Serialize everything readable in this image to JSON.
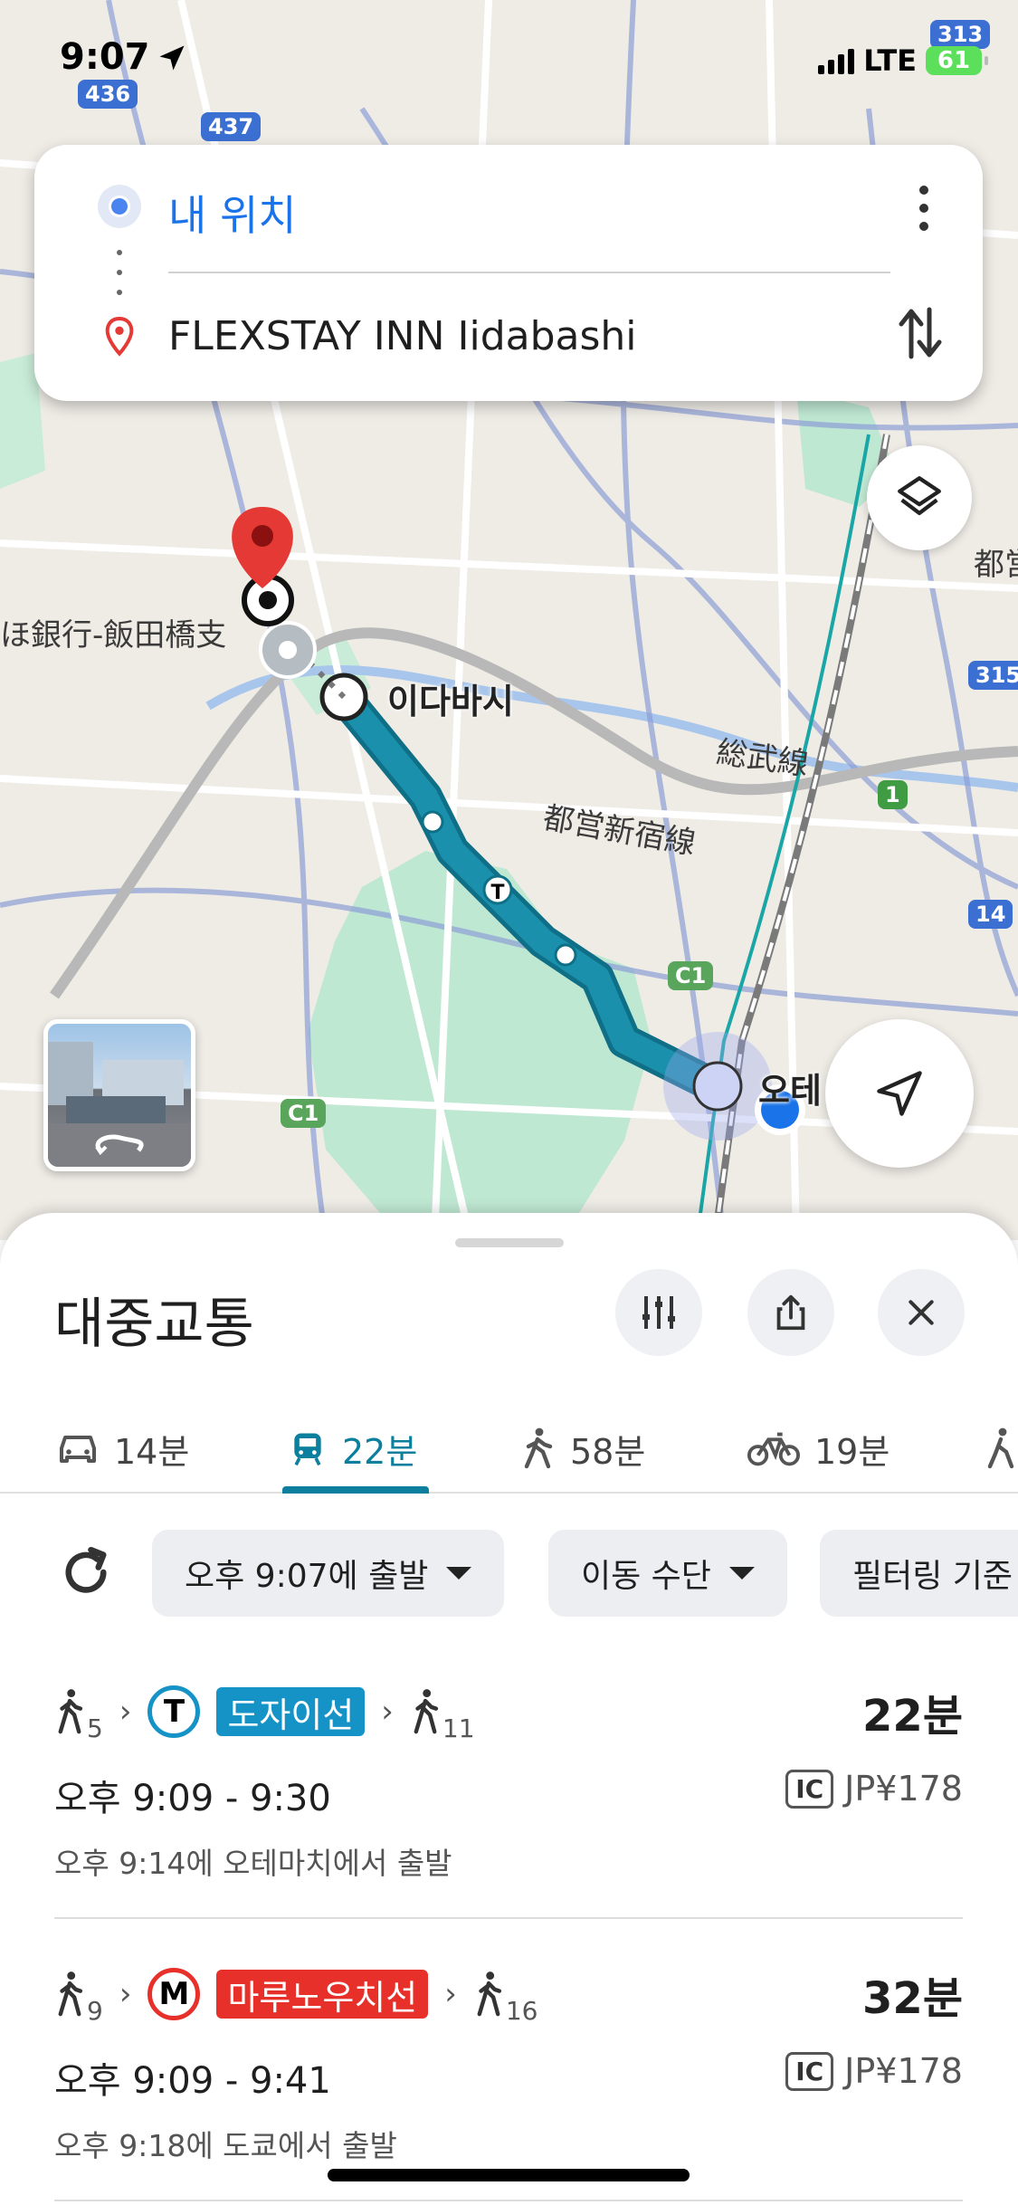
{
  "status_bar": {
    "time": "9:07",
    "network": "LTE",
    "battery": "61"
  },
  "search": {
    "origin": "내 위치",
    "destination": "FLEXSTAY INN Iidabashi"
  },
  "map": {
    "labels": {
      "bank": "ほ銀行-飯田橋支",
      "station_iidabashi": "이다바시",
      "sobu_line": "総武線",
      "shinjuku_line": "都営新宿線",
      "edge_tokyo": "都営",
      "otemachi_partial": "오테"
    },
    "road_numbers": [
      "313",
      "436",
      "437",
      "315",
      "1",
      "14",
      "C1",
      "C1"
    ],
    "route_color": "#1a90ad"
  },
  "sheet": {
    "title": "대중교통",
    "modes": [
      {
        "icon": "car-icon",
        "label": "14분"
      },
      {
        "icon": "train-icon",
        "label": "22분",
        "active": true
      },
      {
        "icon": "walk-icon",
        "label": "58분"
      },
      {
        "icon": "bike-icon",
        "label": "19분"
      }
    ],
    "filters": {
      "depart": "오후 9:07에 출발",
      "mode": "이동 수단",
      "sort": "필터링 기준"
    },
    "routes": [
      {
        "walk_before": "5",
        "line_symbol": "T",
        "line_name": "도자이선",
        "line_color": "#1592c6",
        "walk_after": "11",
        "duration": "22분",
        "times": "오후 9:09 - 9:30",
        "ic": "IC",
        "fare": "JP¥178",
        "depart_info": "오후 9:14에 오테마치에서 출발"
      },
      {
        "walk_before": "9",
        "line_symbol": "M",
        "line_name": "마루노우치선",
        "line_color": "#e8302a",
        "walk_after": "16",
        "duration": "32분",
        "times": "오후 9:09 - 9:41",
        "ic": "IC",
        "fare": "JP¥178",
        "depart_info": "오후 9:18에 도쿄에서 출발"
      }
    ]
  }
}
